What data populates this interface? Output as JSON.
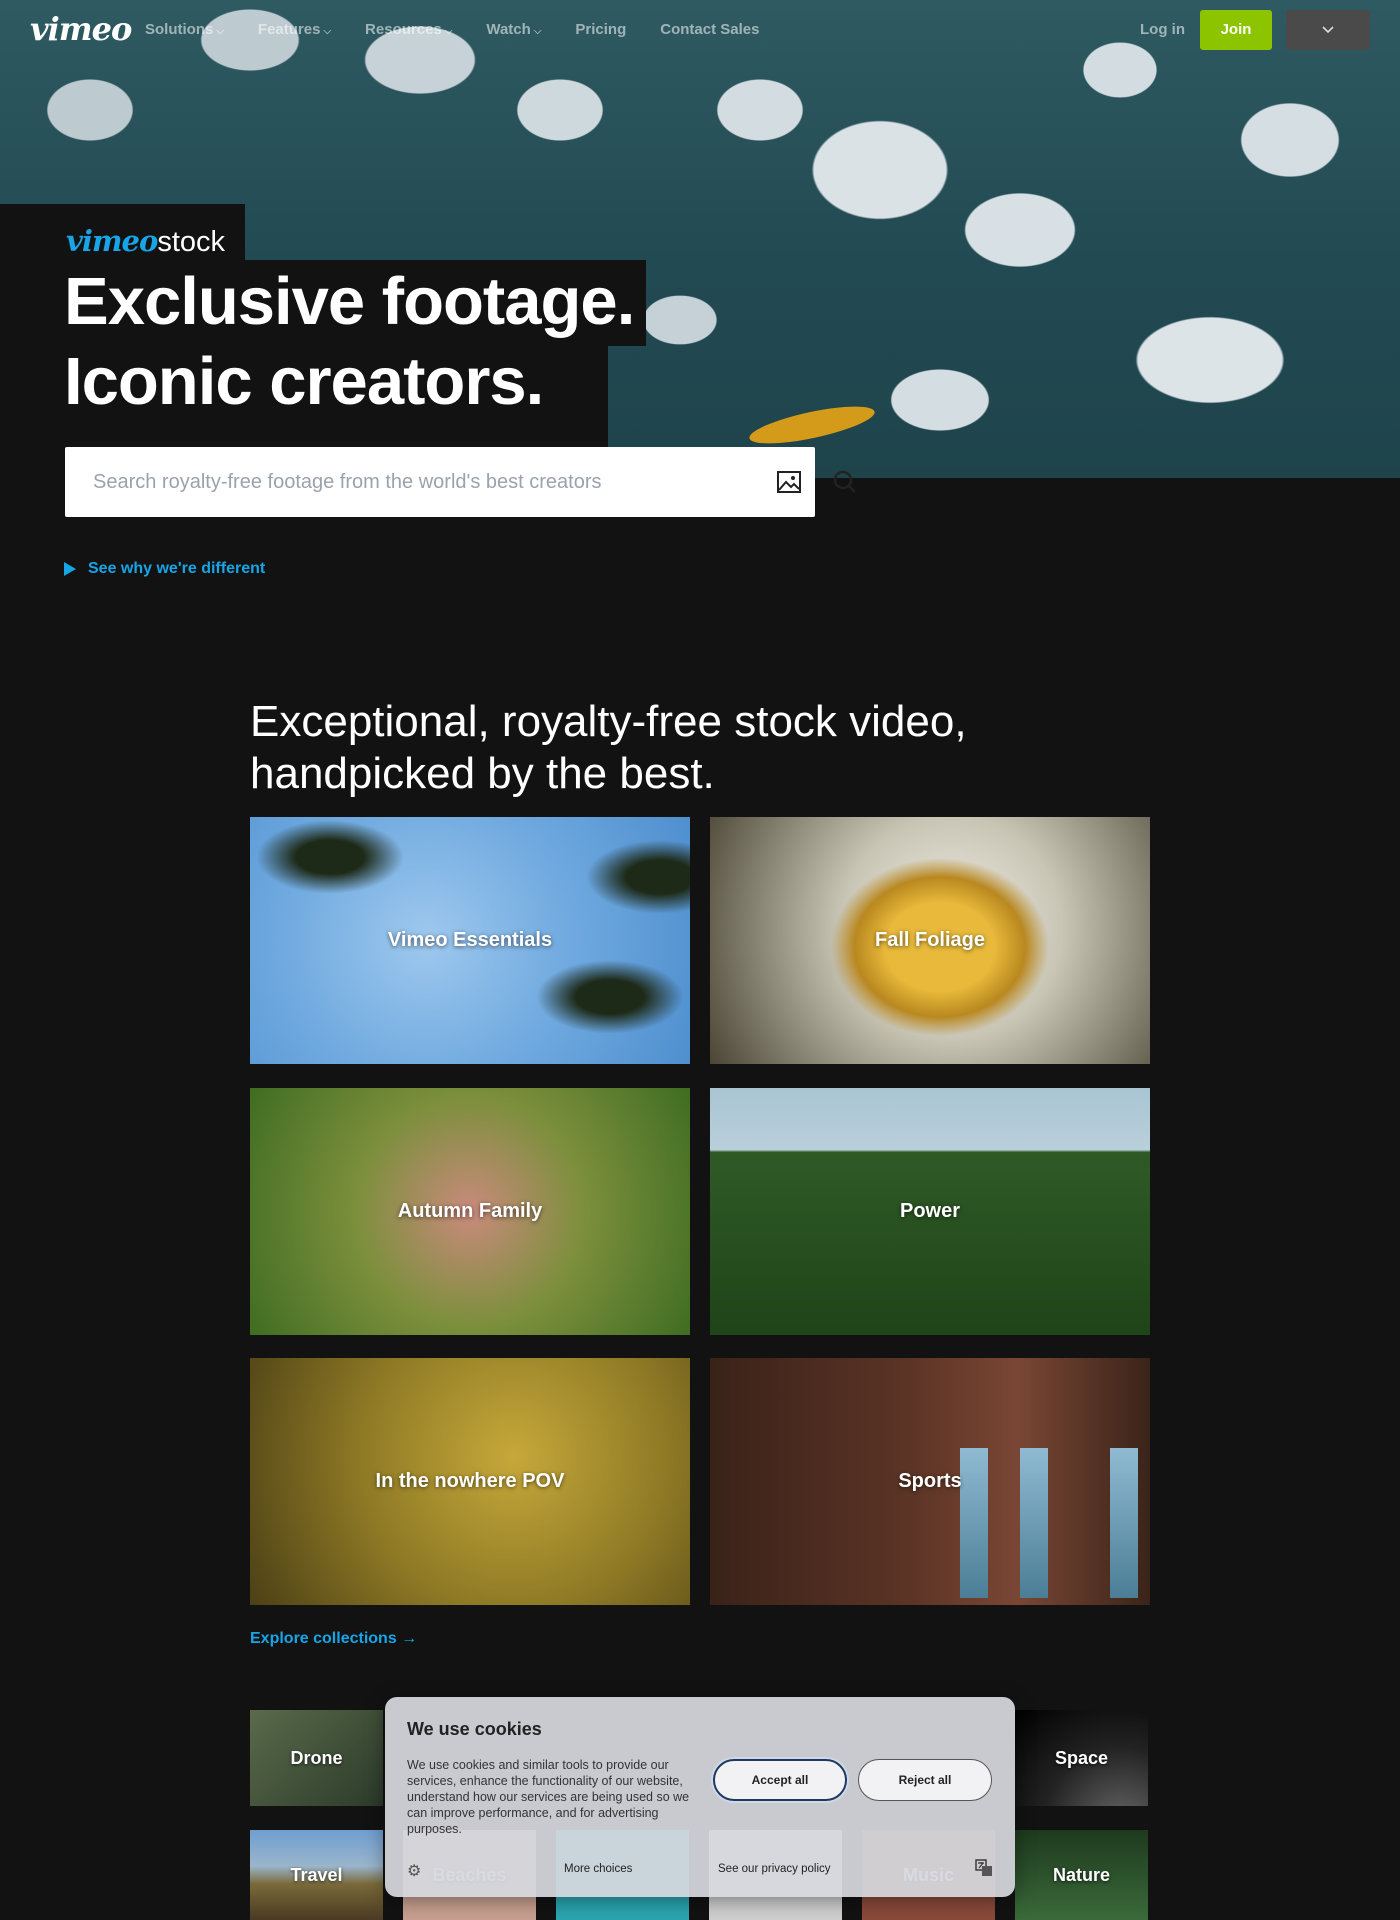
{
  "nav": {
    "logo": "vimeo",
    "links": [
      {
        "label": "Solutions",
        "dropdown": true
      },
      {
        "label": "Features",
        "dropdown": true
      },
      {
        "label": "Resources",
        "dropdown": true
      },
      {
        "label": "Watch",
        "dropdown": true
      },
      {
        "label": "Pricing",
        "dropdown": false
      },
      {
        "label": "Contact Sales",
        "dropdown": false
      }
    ],
    "login": "Log in",
    "join": "Join",
    "dropdown_icon": "chevron-down-icon"
  },
  "hero": {
    "stock_logo_brand": "vimeo",
    "stock_logo_product": "stock",
    "title_line1": "Exclusive footage.",
    "title_line2": "Iconic creators.",
    "search_placeholder": "Search royalty-free footage from the world's best creators",
    "see_why": "See why we're different"
  },
  "collections": {
    "title_line1": "Exceptional, royalty-free stock video,",
    "title_line2": "handpicked by the best.",
    "cards": [
      {
        "label": "Vimeo Essentials"
      },
      {
        "label": "Fall Foliage"
      },
      {
        "label": "Autumn Family"
      },
      {
        "label": "Power"
      },
      {
        "label": "In the nowhere POV"
      },
      {
        "label": "Sports"
      }
    ],
    "explore": "Explore collections →"
  },
  "categories": {
    "row1": [
      {
        "label": "Drone"
      },
      {
        "label": "Space"
      }
    ],
    "row2": [
      {
        "label": "Travel"
      },
      {
        "label": "Beaches"
      },
      {
        "label": "Music"
      },
      {
        "label": "Nature"
      }
    ]
  },
  "cookie": {
    "title": "We use cookies",
    "text": "We use cookies and similar tools to provide our services, enhance the functionality of our website, understand how our services are being used so we can improve performance, and for advertising purposes.",
    "accept": "Accept all",
    "reject": "Reject all",
    "more_choices": "More choices",
    "privacy": "See our privacy policy"
  },
  "colors": {
    "accent": "#17a5e8",
    "join": "#8cc500",
    "background": "#121212"
  }
}
